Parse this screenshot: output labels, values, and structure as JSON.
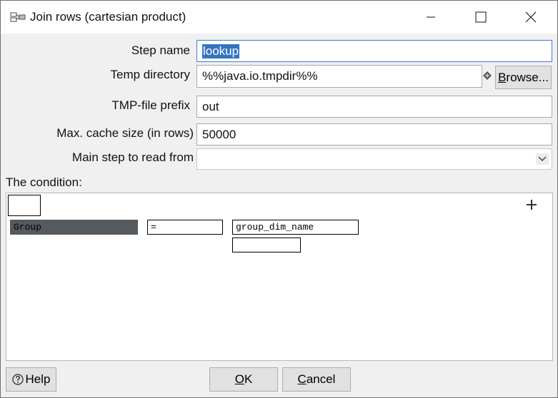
{
  "window": {
    "title": "Join rows (cartesian product)",
    "app_icon": "hop-step-icon",
    "controls": {
      "minimize": "minimize-icon",
      "maximize": "maximize-icon",
      "close": "close-icon"
    }
  },
  "form": {
    "step_name": {
      "label": "Step name",
      "value": "lookup"
    },
    "temp_directory": {
      "label": "Temp directory",
      "value": "%%java.io.tmpdir%%",
      "browse_rest": "rowse...",
      "browse_key": "B"
    },
    "tmp_prefix": {
      "label": "TMP-file prefix",
      "value": "out"
    },
    "max_cache": {
      "label": "Max. cache size (in rows)",
      "value": "50000"
    },
    "main_step": {
      "label": "Main step to read from",
      "value": ""
    }
  },
  "condition": {
    "label": "The condition:",
    "add_icon": "plus-icon",
    "field": "Group",
    "operator": "=",
    "value_field": "group_dim_name",
    "value_constant": ""
  },
  "footer": {
    "help": "Help",
    "ok_key": "O",
    "ok_rest": "K",
    "cancel_key": "C",
    "cancel_rest": "ancel"
  },
  "colors": {
    "selection": "#3573c0",
    "condition_field_bg": "#555a5f",
    "focus_border": "#3c7fd1"
  }
}
